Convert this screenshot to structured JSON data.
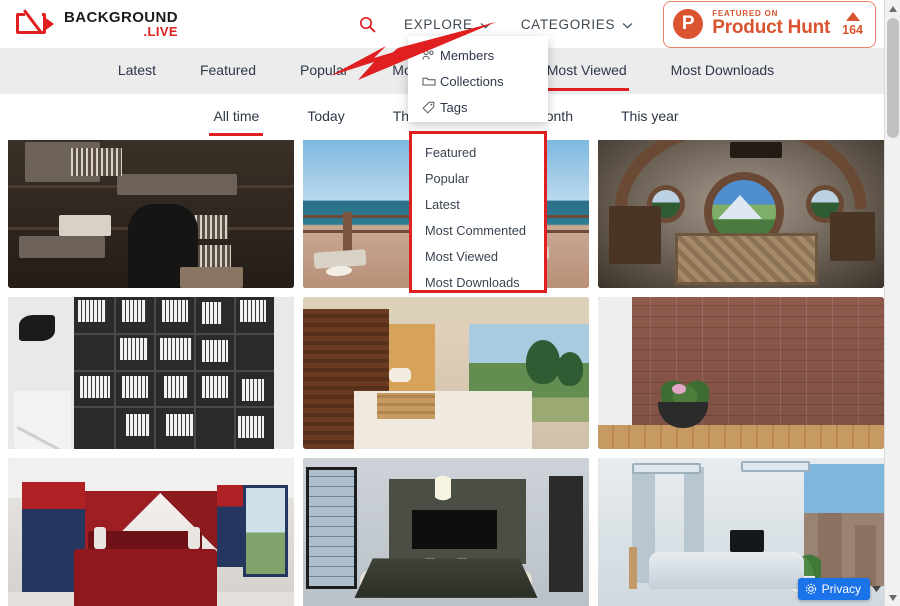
{
  "header": {
    "logo": {
      "name": "BACKGROUND",
      "suffix": ".LIVE",
      "icon": "camera-logo-icon"
    },
    "search_icon": "search-icon",
    "nav": [
      {
        "label": "EXPLORE",
        "chevron": "chevron-down-icon"
      },
      {
        "label": "CATEGORIES",
        "chevron": "chevron-down-icon"
      }
    ],
    "product_hunt": {
      "featured_label": "FEATURED ON",
      "title": "Product Hunt",
      "upvote_icon": "upvote-triangle-icon",
      "votes": "164",
      "logo_letter": "P",
      "accent": "#da552f"
    }
  },
  "subnav": {
    "items": [
      {
        "label": "Latest",
        "active": false
      },
      {
        "label": "Featured",
        "active": false
      },
      {
        "label": "Popular",
        "active": false
      },
      {
        "label": "Most Commented",
        "active": false
      },
      {
        "label": "Most Viewed",
        "active": true
      },
      {
        "label": "Most Downloads",
        "active": false
      }
    ]
  },
  "timenav": {
    "items": [
      {
        "label": "All time",
        "active": true
      },
      {
        "label": "Today",
        "active": false
      },
      {
        "label": "This week",
        "active": false
      },
      {
        "label": "This month",
        "active": false
      },
      {
        "label": "This year",
        "active": false
      }
    ]
  },
  "explore_dropdown": {
    "items": [
      {
        "label": "Members",
        "icon": "members-icon"
      },
      {
        "label": "Collections",
        "icon": "folder-icon"
      },
      {
        "label": "Tags",
        "icon": "tag-icon"
      }
    ]
  },
  "sort_dropdown": {
    "highlight_color": "#e02020",
    "items": [
      {
        "label": "Featured"
      },
      {
        "label": "Popular"
      },
      {
        "label": "Latest"
      },
      {
        "label": "Most Commented"
      },
      {
        "label": "Most Viewed"
      },
      {
        "label": "Most Downloads"
      }
    ]
  },
  "annotation": {
    "arrow_color": "#e02020",
    "arrow_name": "red-pointer-arrow"
  },
  "gallery": {
    "items": [
      {
        "alt": "Dark wood home office with black leather chair and shelves",
        "art": "art-office"
      },
      {
        "alt": "Seaside terrace with sun loungers and ocean view",
        "art": "art-sea"
      },
      {
        "alt": "Hobbit house interior with round windows and mountain view",
        "art": "art-hobbit"
      },
      {
        "alt": "Black bookshelf wall with white books",
        "art": "art-shelf"
      },
      {
        "alt": "Wooden terrace with pallet bench and garden view",
        "art": "art-terrace"
      },
      {
        "alt": "Red brick wall with potted flowering plant",
        "art": "art-brick"
      },
      {
        "alt": "Red and navy superhero themed bedroom",
        "art": "art-bedroom"
      },
      {
        "alt": "Modern meeting room with long table and chandelier",
        "art": "art-meeting"
      },
      {
        "alt": "Modern office desk with monitor, plant and city view",
        "art": "art-desk"
      }
    ]
  },
  "privacy": {
    "label": "Privacy",
    "icon": "gear-icon",
    "caret": "caret-down-icon",
    "color": "#1a73e8"
  },
  "scrollbar": {
    "up": "scroll-up-arrow",
    "down": "scroll-down-arrow",
    "thumb": "scroll-thumb"
  }
}
